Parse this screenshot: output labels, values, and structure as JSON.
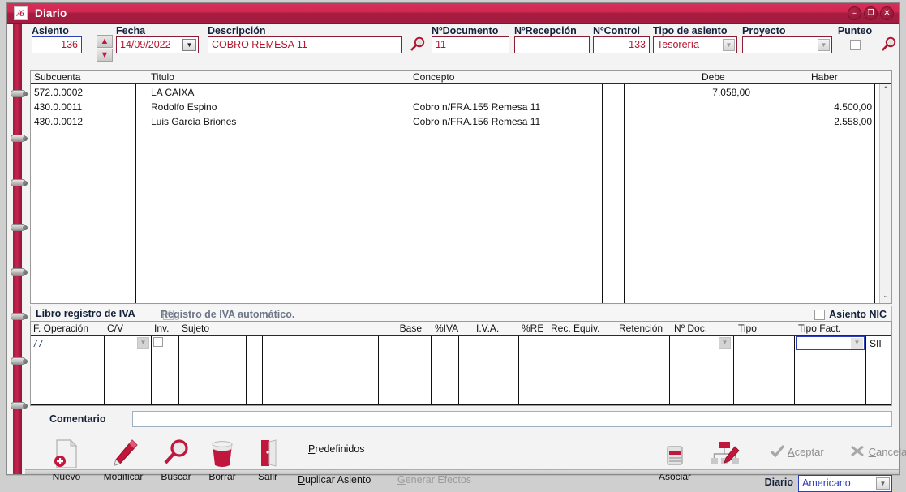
{
  "window": {
    "title": "Diario",
    "app_icon": "book-icon",
    "minimize": "–",
    "maximize": "❐",
    "close": "✕"
  },
  "header": {
    "asiento": {
      "label": "Asiento",
      "value": "136"
    },
    "fecha": {
      "label": "Fecha",
      "value": "14/09/2022"
    },
    "descripcion": {
      "label": "Descripción",
      "value": "COBRO REMESA 11"
    },
    "n_documento": {
      "label": "NºDocumento",
      "value": "11"
    },
    "n_recepcion": {
      "label": "NºRecepción",
      "value": ""
    },
    "n_control": {
      "label": "NºControl",
      "value": "133"
    },
    "tipo_asiento": {
      "label": "Tipo de asiento",
      "value": "Tesorería"
    },
    "proyecto": {
      "label": "Proyecto",
      "value": ""
    },
    "punteo": {
      "label": "Punteo",
      "checked": false
    }
  },
  "grid": {
    "columns": [
      "Subcuenta",
      "Titulo",
      "Concepto",
      "Debe",
      "Haber"
    ],
    "rows": [
      {
        "subcuenta": "572.0.0002",
        "titulo": "LA CAIXA",
        "concepto": "",
        "debe": "7.058,00",
        "haber": ""
      },
      {
        "subcuenta": "430.0.0011",
        "titulo": "Rodolfo Espino",
        "concepto": "Cobro n/FRA.155 Remesa 11",
        "debe": "",
        "haber": "4.500,00"
      },
      {
        "subcuenta": "430.0.0012",
        "titulo": "Luis García Briones",
        "concepto": "Cobro n/FRA.156 Remesa 11",
        "debe": "",
        "haber": "2.558,00"
      }
    ]
  },
  "iva": {
    "section_title": "Libro registro de IVA",
    "auto_label": "Registro de IVA automático.",
    "auto_checked": true,
    "asiento_nic": {
      "label": "Asiento NIC",
      "checked": false
    },
    "columns": [
      "F. Operación",
      "C/V",
      "Inv.",
      "Sujeto",
      "",
      "",
      "Base",
      "%IVA",
      "I.V.A.",
      "%RE",
      "Rec. Equiv.",
      "Retención",
      "Nº Doc.",
      "Tipo",
      "Tipo Fact.",
      ""
    ],
    "row": {
      "f_operacion": "/ /",
      "sii": "SII"
    }
  },
  "comentario": {
    "label": "Comentario",
    "value": "",
    "placeholder": ""
  },
  "toolbar": {
    "buttons": [
      {
        "label": "Nuevo",
        "icon": "new-document-icon"
      },
      {
        "label": "Modificar",
        "icon": "pen-icon"
      },
      {
        "label": "Buscar",
        "icon": "magnifier-icon"
      },
      {
        "label": "Borrar",
        "icon": "trash-icon"
      },
      {
        "label": "Salir",
        "icon": "exit-door-icon"
      }
    ],
    "links": [
      {
        "label": "Predefinidos",
        "enabled": true
      },
      {
        "label": "Duplicar Asiento",
        "enabled": true
      },
      {
        "label": "Generar Efectos",
        "enabled": false
      }
    ],
    "asociar": {
      "label": "Asociar",
      "icon": "printer-icon"
    },
    "diagram_icon": "diagram-edit-icon",
    "aceptar": {
      "label": "Aceptar",
      "icon": "check-icon",
      "enabled": false
    },
    "cancelar": {
      "label": "Cancelar",
      "icon": "x-icon",
      "enabled": false
    },
    "diario": {
      "label": "Diario",
      "value": "Americano"
    }
  },
  "colors": {
    "titlebar_top": "#d6305a",
    "titlebar_bottom": "#a81d42",
    "accent_red": "#b3152f",
    "field_border": "#8c1c33",
    "focus_blue": "#2b3fbb",
    "label_navy": "#14213a",
    "binder_strip": "#c52450"
  }
}
